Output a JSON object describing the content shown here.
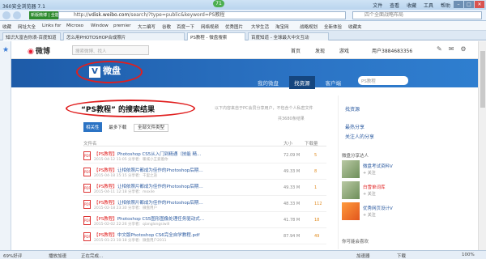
{
  "window": {
    "title": "360安全浏览器 7.1",
    "menus": [
      "文件",
      "查看",
      "收藏",
      "工具",
      "帮助"
    ],
    "badge": "71"
  },
  "nav": {
    "addr_tag": "新版微博 | 全能",
    "url_prefix": "http://",
    "host": "vdisk.weibo.com",
    "url_rest": "/search/?type=public&keyword=PS教程",
    "search_placeholder": "四个全面战略布局"
  },
  "favorites": [
    "收藏",
    "网址大全",
    "Links for",
    "Microso",
    "Window",
    "premier",
    "大二编写",
    "谷歌",
    "百度一下",
    "网络视频",
    "优秀图片",
    "大学生活",
    "淘宝网",
    "战略规划",
    "全新体验",
    "收藏夹"
  ],
  "tabs": [
    "知识大富吉你浪-百度知道",
    "怎么用PHOTOSHOP合成照片",
    "PS教程 - 微盘搜索",
    "百度知道 - 全球最大中文互动"
  ],
  "weibo": {
    "logo": "微博",
    "search_placeholder": "搜索微博、找人",
    "nav": [
      "首页",
      "发现",
      "游戏"
    ],
    "user": "用户3884683356"
  },
  "vdisk": {
    "logo": "微盘",
    "nav": [
      "我的微盘",
      "找资源",
      "客户端"
    ],
    "active_nav": "找资源",
    "search_placeholder": "PS教程"
  },
  "results": {
    "title": "“PS教程” 的搜索结果",
    "note": "以下内容来自于PC会员分享用户，不包含个人私密文件",
    "count": "共3680条结果",
    "filters": [
      "相关性",
      "最多下载"
    ],
    "type_select": "全部文件类型",
    "col_name": "文件名",
    "col_size": "大小",
    "col_dl": "下载量",
    "rows": [
      {
        "tag": "【PS教程】",
        "name": "Photoshop CS5从入门到精通（技能 精…",
        "meta": "2015-04-12 11:05 分享者：暖城小王爱着你",
        "size": "72.09 M",
        "dl": "5"
      },
      {
        "tag": "【PS教程】",
        "name": "让相依照片都成为佳作的Photoshop后期…",
        "meta": "2015-04-18 15:15 分享者：千里之途",
        "size": "49.33 M",
        "dl": "8"
      },
      {
        "tag": "【PS教程】",
        "name": "让相依照片都成为佳作的Photoshop后期…",
        "meta": "2015-04-11 12:18 分享者：moxile",
        "size": "49.33 M",
        "dl": "1"
      },
      {
        "tag": "【PS教程】",
        "name": "让相依照片都成为佳作的Photoshop后期…",
        "meta": "2015-02-18 23:30 分享者：微盘用户",
        "size": "48.33 M",
        "dl": "112"
      },
      {
        "tag": "【PS教程】",
        "name": "Photoshop CS5图形图像处理任务驱动式…",
        "meta": "2015-02-02 22:26 分享者：qianglongsiwill",
        "size": "41.78 M",
        "dl": "18"
      },
      {
        "tag": "【PS教程】",
        "name": "中文版Photoshop CS6完全自学教程.pdf",
        "meta": "2015-01-23 10:18 分享者：微盘用户2011",
        "size": "87.94 M",
        "dl": "49"
      }
    ]
  },
  "right": {
    "links": [
      "找资源",
      "最热分享",
      "关注人的分享"
    ],
    "users_section": "微盘分享达人",
    "users": [
      {
        "name": "微盘考试资料V",
        "follow": "+ 关注"
      },
      {
        "name": "白雪单词库",
        "follow": "+ 关注"
      },
      {
        "name": "优秀网页设计V",
        "follow": "+ 关注"
      }
    ],
    "hot_section": "你可能会喜欢"
  },
  "status": {
    "left": "69%好评",
    "mid1": "播放加速",
    "mid2": "正在完成...",
    "right1": "加速器",
    "right2": "下载",
    "zoom": "100%"
  },
  "colors": {
    "brand_blue": "#2b73c4",
    "annotation_red": "#e01f1f"
  }
}
